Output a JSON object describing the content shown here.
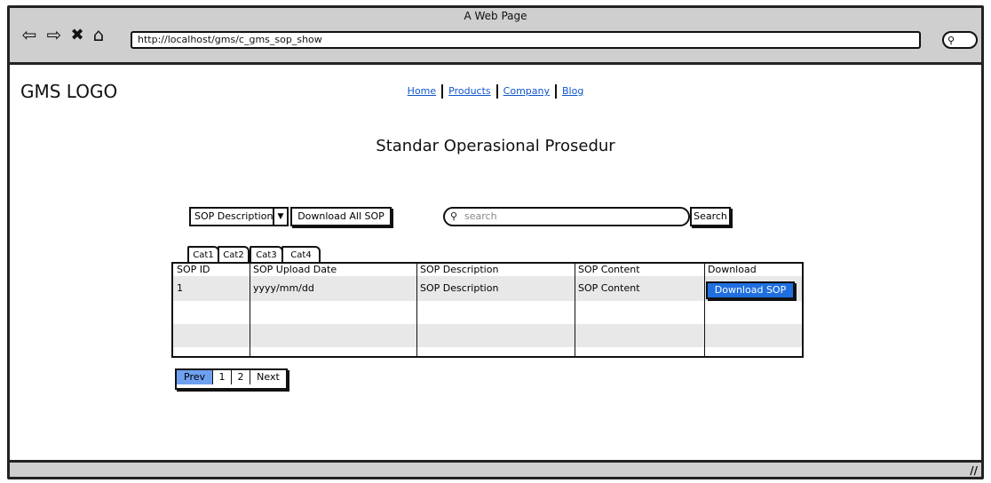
{
  "window": {
    "title": "A Web Page",
    "url": "http://localhost/gms/c_gms_sop_show"
  },
  "icons": {
    "back": "arrow-left-icon",
    "forward": "arrow-right-icon",
    "stop": "close-icon",
    "home": "home-icon",
    "search": "search-icon",
    "resize": "resize-handle-icon"
  },
  "header": {
    "logo": "GMS LOGO"
  },
  "nav": {
    "items": [
      "Home",
      "Products",
      "Company",
      "Blog"
    ]
  },
  "page": {
    "title": "Standar Operasional Prosedur"
  },
  "toolbar": {
    "select_value": "SOP Description",
    "download_all_label": "Download All SOP",
    "search_placeholder": "search",
    "search_button_label": "Search"
  },
  "tabs": [
    "Cat1",
    "Cat2",
    "Cat3",
    "Cat4"
  ],
  "table": {
    "headers": [
      "SOP ID",
      "SOP Upload Date",
      "SOP Description",
      "SOP Content",
      "Download"
    ],
    "rows": [
      [
        "1",
        "yyyy/mm/dd",
        "SOP Description",
        "SOP Content",
        "Download SOP"
      ]
    ]
  },
  "pagination": {
    "prev": "Prev",
    "pages": [
      "1",
      "2"
    ],
    "next": "Next"
  },
  "colors": {
    "primary_button": "#1f6fe0",
    "active_page": "#6fa0f0",
    "chrome": "#cfcfcf",
    "link": "#1155cc"
  }
}
